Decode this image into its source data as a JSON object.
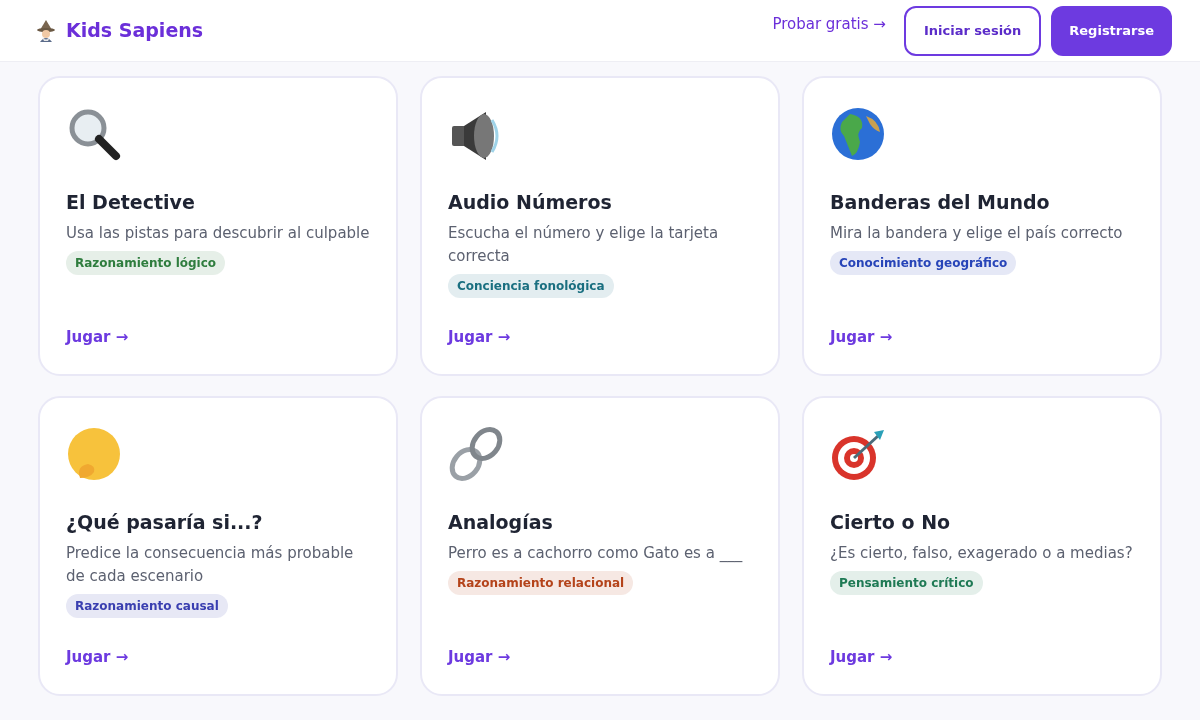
{
  "brand": {
    "name": "Kids Sapiens"
  },
  "nav": {
    "try_link": "Probar gratis →",
    "login_button": "Iniciar sesión",
    "signup_button": "Registrarse"
  },
  "games": [
    {
      "title": "El Detective",
      "description": "Usa las pistas para descubrir al culpable",
      "tag": "Razonamiento lógico",
      "color": "#2f7d3e",
      "link": "Jugar →"
    },
    {
      "title": "Audio Números",
      "description": "Escucha el número y elige la tarjeta correcta",
      "tag": "Conciencia fonológica",
      "color": "#1a6f80",
      "link": "Jugar →"
    },
    {
      "title": "Banderas del Mundo",
      "description": "Mira la bandera y elige el país correcto",
      "tag": "Conocimiento geográfico",
      "color": "#2744b8",
      "link": "Jugar →"
    },
    {
      "title": "¿Qué pasaría si...?",
      "description": "Predice la consecuencia más probable de cada escenario",
      "tag": "Razonamiento causal",
      "color": "#3a3fb0",
      "link": "Jugar →"
    },
    {
      "title": "Analogías",
      "description": "Perro es a cachorro como Gato es a ___",
      "tag": "Razonamiento relacional",
      "color": "#b4431a",
      "link": "Jugar →"
    },
    {
      "title": "Cierto o No",
      "description": "¿Es cierto, falso, exagerado o a medias?",
      "tag": "Pensamiento crítico",
      "color": "#1f7a55",
      "link": "Jugar →"
    }
  ]
}
